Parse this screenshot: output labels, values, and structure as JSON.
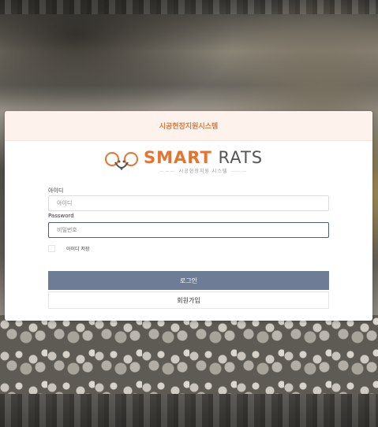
{
  "header": {
    "title": "시공현장지원시스템"
  },
  "logo": {
    "brand_smart": "SMART",
    "brand_rats": " RATS",
    "subtitle": "시공현장지원 시스템"
  },
  "form": {
    "id_label": "아이디",
    "id_placeholder": "아이디",
    "password_label": "Password",
    "password_placeholder": "비밀번호",
    "remember_label": "아이디 저장",
    "remember_checked": false
  },
  "buttons": {
    "login": "로그인",
    "join": "회원가입"
  },
  "colors": {
    "accent": "#e8732f",
    "login_button": "#6e7c95",
    "header_bg": "#fdf3ec"
  }
}
